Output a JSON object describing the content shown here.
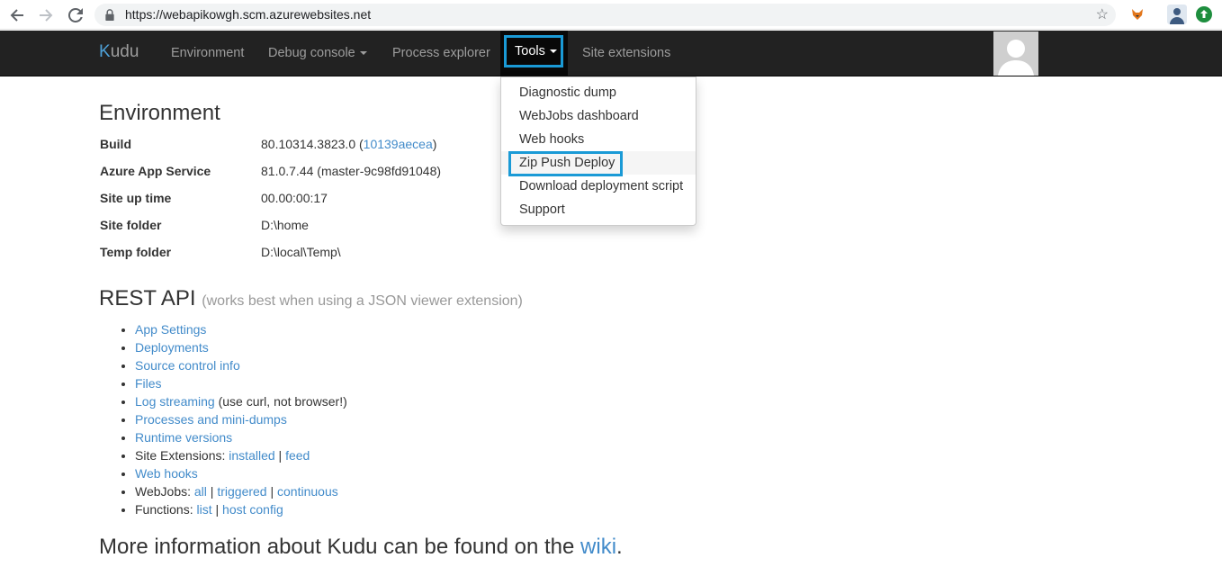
{
  "browser": {
    "url": "https://webapikowgh.scm.azurewebsites.net"
  },
  "navbar": {
    "brand": "Kudu",
    "brand_k": "K",
    "brand_rest": "udu",
    "items": {
      "environment": "Environment",
      "debug_console": "Debug console",
      "process_explorer": "Process explorer",
      "tools": "Tools",
      "site_extensions": "Site extensions"
    }
  },
  "tools_menu": {
    "items": [
      "Diagnostic dump",
      "WebJobs dashboard",
      "Web hooks",
      "Zip Push Deploy",
      "Download deployment script",
      "Support"
    ]
  },
  "environment": {
    "title": "Environment",
    "rows": [
      {
        "label": "Build",
        "value": "80.10314.3823.0 (",
        "link": "10139aecea",
        "tail": ")"
      },
      {
        "label": "Azure App Service",
        "value": "81.0.7.44 (master-9c98fd91048)"
      },
      {
        "label": "Site up time",
        "value": "00.00:00:17"
      },
      {
        "label": "Site folder",
        "value": "D:\\home"
      },
      {
        "label": "Temp folder",
        "value": "D:\\local\\Temp\\"
      }
    ]
  },
  "rest_api": {
    "title": "REST API",
    "subtitle": "(works best when using a JSON viewer extension)",
    "items": {
      "app_settings": "App Settings",
      "deployments": "Deployments",
      "source_control": "Source control info",
      "files": "Files",
      "log_streaming": "Log streaming",
      "log_streaming_note": " (use curl, not browser!)",
      "processes": "Processes and mini-dumps",
      "runtime": "Runtime versions",
      "site_ext_label": "Site Extensions: ",
      "site_ext_installed": "installed",
      "site_ext_feed": "feed",
      "web_hooks": "Web hooks",
      "webjobs_label": "WebJobs: ",
      "webjobs_all": "all",
      "webjobs_triggered": "triggered",
      "webjobs_continuous": "continuous",
      "functions_label": "Functions: ",
      "functions_list": "list",
      "functions_host": "host config",
      "separator": " | "
    }
  },
  "footer": {
    "text": "More information about Kudu can be found on the ",
    "link": "wiki",
    "end": "."
  },
  "colors": {
    "navbar_bg": "#222222",
    "highlight": "#1a9ad6",
    "link": "#428bca"
  },
  "icons": [
    "back-arrow-icon",
    "forward-arrow-icon",
    "reload-icon",
    "lock-icon",
    "star-icon",
    "fox-extension-icon",
    "profile-icon",
    "update-icon",
    "user-avatar-icon"
  ]
}
